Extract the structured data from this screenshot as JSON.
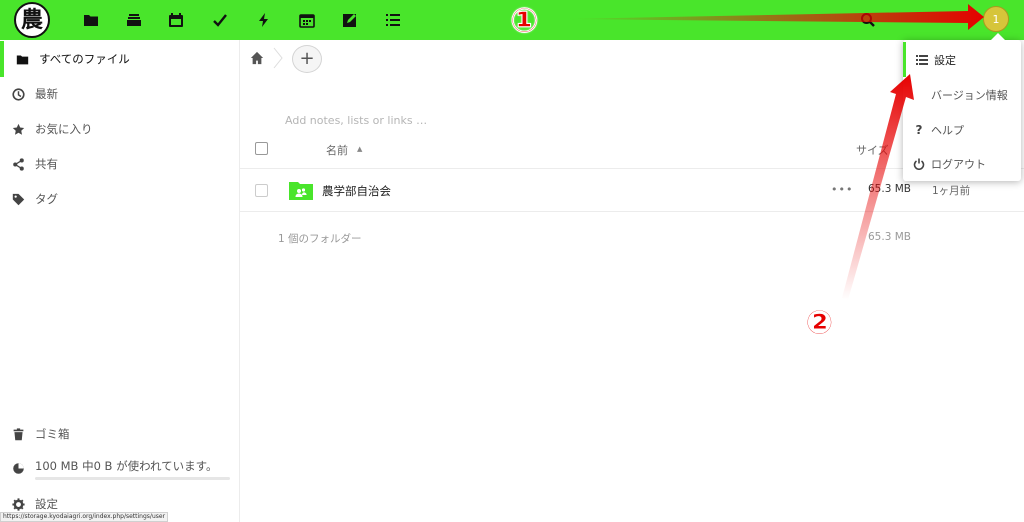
{
  "header": {
    "logo_text": "農",
    "apps": [
      {
        "name": "files-icon",
        "icon": "folder"
      },
      {
        "name": "deck-icon",
        "icon": "stack"
      },
      {
        "name": "calendar-icon",
        "icon": "calendar"
      },
      {
        "name": "tasks-icon",
        "icon": "check"
      },
      {
        "name": "activity-icon",
        "icon": "lightning"
      },
      {
        "name": "schedule-icon",
        "icon": "calendar-grid"
      },
      {
        "name": "notes-icon",
        "icon": "pencil-square"
      },
      {
        "name": "checklist-icon",
        "icon": "list"
      }
    ],
    "avatar_text": "1",
    "accent_color": "#49e52b"
  },
  "sidebar": {
    "items": [
      {
        "label": "すべてのファイル",
        "icon": "folder-icon"
      },
      {
        "label": "最新",
        "icon": "clock-icon"
      },
      {
        "label": "お気に入り",
        "icon": "star-icon"
      },
      {
        "label": "共有",
        "icon": "share-icon"
      },
      {
        "label": "タグ",
        "icon": "tag-icon"
      }
    ],
    "trash_label": "ゴミ箱",
    "quota_label": "100 MB 中0 B が使われています。",
    "quota_fraction": 0,
    "settings_label": "設定",
    "status_url": "https://storage.kyodaiagri.org/index.php/settings/user"
  },
  "main": {
    "notes_placeholder": "Add notes, lists or links …",
    "columns": {
      "name": "名前",
      "size": "サイズ"
    },
    "files": [
      {
        "name": "農学部自治会",
        "size": "65.3 MB",
        "modified": "1ヶ月前"
      }
    ],
    "summary": {
      "label": "1 個のフォルダー",
      "size": "65.3 MB"
    }
  },
  "dropdown": {
    "items": [
      {
        "label": "設定",
        "icon": "settings-list-icon"
      },
      {
        "label": "バージョン情報",
        "icon": "info-icon"
      },
      {
        "label": "ヘルプ",
        "icon": "help-icon"
      },
      {
        "label": "ログアウト",
        "icon": "power-icon"
      }
    ]
  },
  "annotations": {
    "step1": "①",
    "step2": "②",
    "color": "#e60000"
  }
}
